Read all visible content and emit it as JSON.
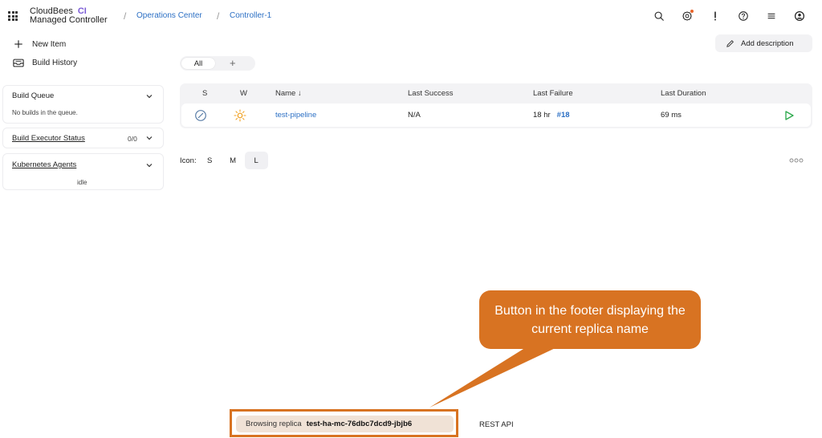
{
  "header": {
    "brand_line1": "CloudBees",
    "brand_ci": "CI",
    "brand_line2": "Managed Controller",
    "breadcrumbs": [
      "Operations Center",
      "Controller-1"
    ],
    "icons": [
      "search-icon",
      "settings-icon",
      "alert-icon",
      "help-icon",
      "menu-icon",
      "user-icon"
    ]
  },
  "sidebar": {
    "tasks": [
      {
        "label": "New Item",
        "icon": "plus-icon"
      },
      {
        "label": "Build History",
        "icon": "inbox-icon"
      }
    ],
    "build_queue": {
      "title": "Build Queue",
      "empty_text": "No builds in the queue."
    },
    "executor_status": {
      "title": "Build Executor Status",
      "count": "0/0"
    },
    "kubernetes_agents": {
      "title": "Kubernetes Agents",
      "status": "idle"
    }
  },
  "main": {
    "add_description": "Add description",
    "view_tabs": {
      "all": "All",
      "add": "+"
    },
    "table": {
      "headers": {
        "s": "S",
        "w": "W",
        "name": "Name",
        "name_sort": "↓",
        "last_success": "Last Success",
        "last_failure": "Last Failure",
        "last_duration": "Last Duration"
      },
      "rows": [
        {
          "name": "test-pipeline",
          "last_success": "N/A",
          "last_failure": "18 hr",
          "failure_build": "#18",
          "last_duration": "69 ms"
        }
      ]
    },
    "icon_size": {
      "label": "Icon:",
      "options": [
        "S",
        "M",
        "L"
      ],
      "selected": "L"
    }
  },
  "callout": {
    "text": "Button in the footer displaying the current replica name",
    "color": "#d87322"
  },
  "footer": {
    "replica_label": "Browsing replica",
    "replica_name": "test-ha-mc-76dbc7dcd9-jbjb6",
    "rest_api": "REST API"
  },
  "colors": {
    "link": "#2b6fc4",
    "brand_ci": "#7b5cd6",
    "success": "#2aa84a",
    "weather": "#f0a020"
  }
}
